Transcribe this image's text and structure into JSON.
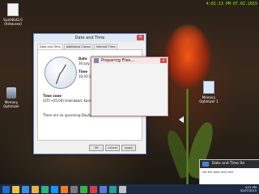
{
  "clock_top": "4:01:13 PM 07.02.2015",
  "desktop_icons": [
    {
      "label": "Sys64bit2.0 (hshw.exe)",
      "type": "file"
    },
    {
      "label": "Memory Optimizer",
      "type": "app"
    },
    {
      "label": "Memory Optimizer 1",
      "type": "app"
    }
  ],
  "dialog": {
    "title": "Date and Time",
    "tabs": [
      "Date and Time",
      "Additional Clocks",
      "Internet Time"
    ],
    "date_label": "Date",
    "date_value": "30 July 20",
    "time_label": "Time",
    "time_value": "16:03:13",
    "timezone_label": "Time zone",
    "timezone_value": "(UTC+05:00) Islamabad, Karachi",
    "dst_note": "There are no upcoming Daylight Savi",
    "ok": "OK",
    "cancel": "Cancel",
    "apply": "Apply"
  },
  "preparing": {
    "title": "Preparing Files..."
  },
  "notification": {
    "title": "Date and Time Se",
    "body": "Set the date and time"
  },
  "taskbar": {
    "items": [
      "start",
      "file-explorer",
      "ie",
      "folder",
      "store",
      "mail",
      "media",
      "settings",
      "camtasia",
      "app1",
      "app2",
      "app3",
      "app4"
    ],
    "tray_time": "4:01 PM",
    "tray_date": "02/07/2015",
    "colors": [
      "#1e6fd0",
      "#f0c040",
      "#3a8ee6",
      "#e8b040",
      "#2bb673",
      "#1e90ff",
      "#ff7a1a",
      "#7a7a7a",
      "#3cb043",
      "#d04040",
      "#5a7ad0",
      "#2a9a9a",
      "#c0c0c0"
    ]
  }
}
